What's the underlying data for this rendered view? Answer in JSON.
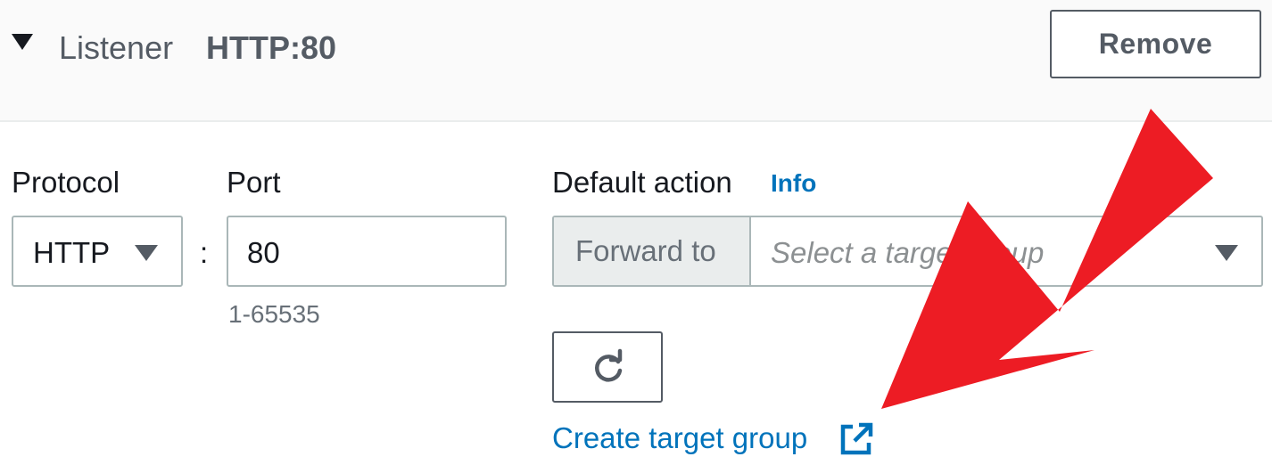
{
  "header": {
    "title": "Listener",
    "subtitle": "HTTP:80",
    "remove_label": "Remove"
  },
  "protocol": {
    "label": "Protocol",
    "value": "HTTP"
  },
  "separator": ":",
  "port": {
    "label": "Port",
    "value": "80",
    "hint": "1-65535"
  },
  "default_action": {
    "label": "Default action",
    "info_label": "Info",
    "prefix": "Forward to",
    "placeholder": "Select a target group"
  },
  "create_link": {
    "label": "Create target group"
  },
  "icons": {
    "toggle": "caret-down-icon",
    "refresh": "refresh-icon",
    "external": "external-link-icon"
  },
  "colors": {
    "link": "#0073bb",
    "annotation_arrow": "#ed1c24"
  }
}
